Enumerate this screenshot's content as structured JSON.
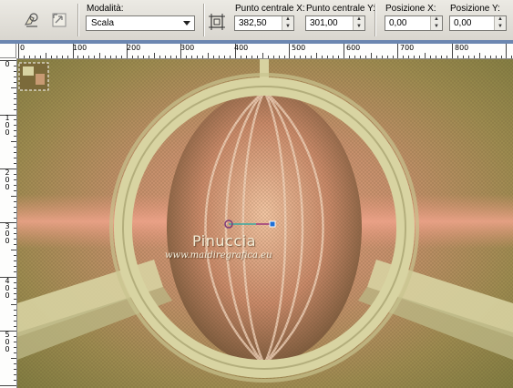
{
  "toolbar": {
    "preset_icon": "pick-tool-preset-icon",
    "reset_icon": "reset-icon",
    "mode": {
      "label": "Modalità:",
      "value": "Scala"
    },
    "apply_icon": "center-on-canvas-icon",
    "center_x": {
      "label": "Punto centrale X:",
      "value": "382,50"
    },
    "center_y": {
      "label": "Punto centrale Y:",
      "value": "301,00"
    },
    "pos_x": {
      "label": "Posizione X:",
      "value": "0,00"
    },
    "pos_y": {
      "label": "Posizione Y:",
      "value": "0,00"
    }
  },
  "ruler": {
    "h_labels": [
      "0",
      "100",
      "200",
      "300",
      "400",
      "500",
      "600",
      "700",
      "800"
    ],
    "v_labels": [
      "0",
      "100",
      "200",
      "300",
      "400",
      "500"
    ]
  },
  "canvas": {
    "watermark_name": "Pinuccia",
    "watermark_url": "www.maidiregrafica.eu"
  },
  "colors": {
    "toolbar_bg": "#d9d6cf",
    "frame_blue": "#6b86b0",
    "ring": "#d6d29f",
    "bg_olive": "#8c8c4f",
    "bg_salmon": "#d79a78"
  }
}
